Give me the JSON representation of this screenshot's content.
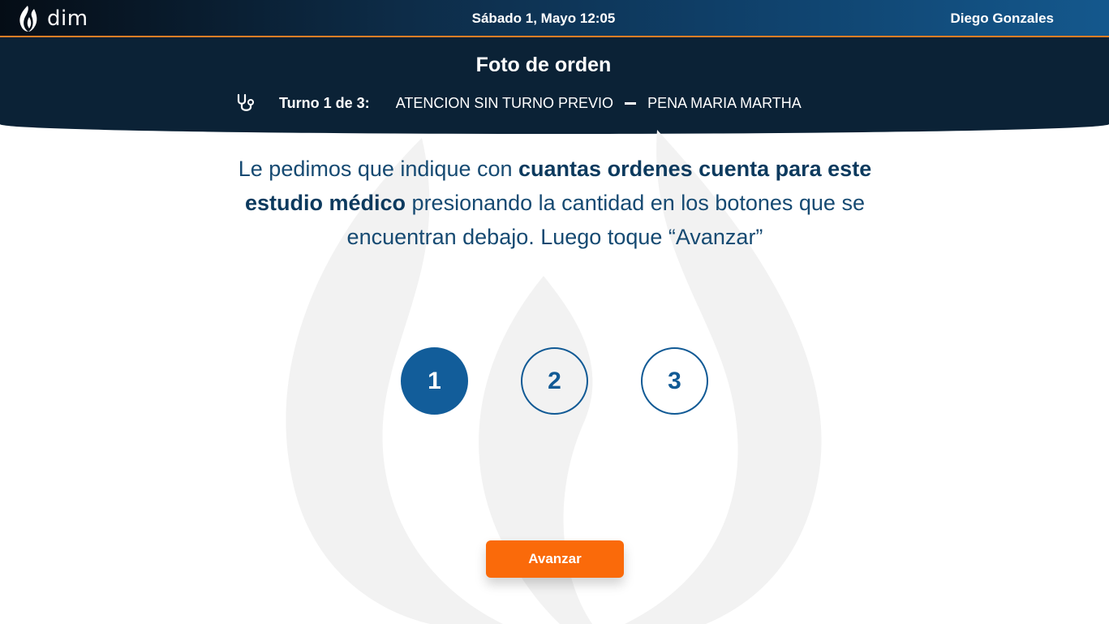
{
  "app": {
    "logo_text": "dim"
  },
  "topbar": {
    "date": "Sábado 1, Mayo",
    "time": "12:05",
    "user_name": "Diego Gonzales"
  },
  "header": {
    "title": "Foto de orden",
    "turno_label": "Turno 1 de 3:",
    "turno_type": "ATENCION SIN TURNO PREVIO",
    "patient_name": "PENA MARIA MARTHA"
  },
  "instructions": {
    "part1": "Le pedimos que indique con ",
    "bold1": "cuantas ordenes cuenta para este estudio médico",
    "part2": " presionando la cantidad en los botones que se encuentran debajo. Luego toque “Avanzar”"
  },
  "quantity": {
    "options": [
      "1",
      "2",
      "3"
    ],
    "selected": "1"
  },
  "actions": {
    "advance_label": "Avanzar"
  },
  "colors": {
    "primary": "#125d9a",
    "accent": "#fa6a0a",
    "header_bg": "#0b2236",
    "text": "#164a72"
  },
  "icons": {
    "logo": "dim-flame-logo-icon",
    "turno": "stethoscope-icon"
  }
}
